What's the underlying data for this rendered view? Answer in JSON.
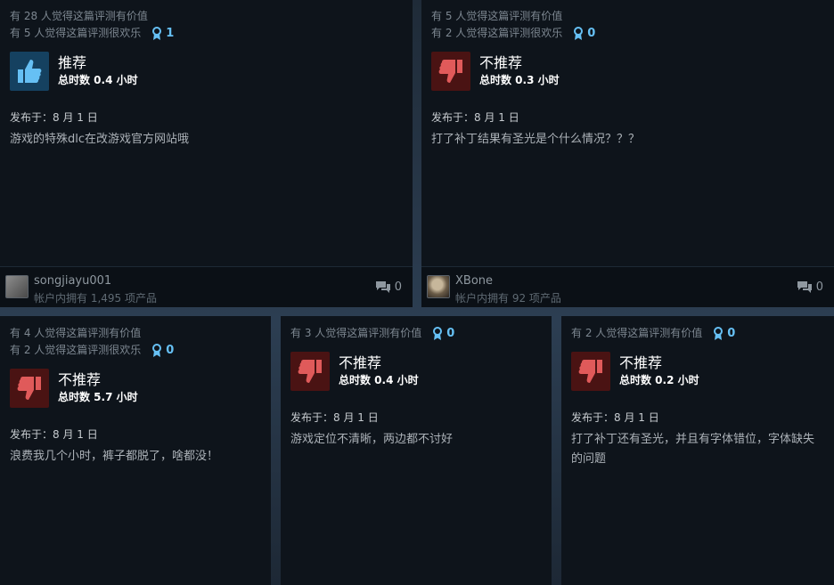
{
  "reviews": [
    {
      "helpful_line1": "有 28 人觉得这篇评测有价值",
      "helpful_line2": "有 5 人觉得这篇评测很欢乐",
      "awards": "1",
      "verdict": "推荐",
      "hours": "总时数 0.4 小时",
      "posted": "发布于：8 月 1 日",
      "body": "游戏的特殊dlc在改游戏官方网站哦",
      "username": "songjiayu001",
      "products": "帐户内拥有 1,495 项产品",
      "comments": "0",
      "thumb": "thumbs-up"
    },
    {
      "helpful_line1": "有 5 人觉得这篇评测有价值",
      "helpful_line2": "有 2 人觉得这篇评测很欢乐",
      "awards": "0",
      "verdict": "不推荐",
      "hours": "总时数 0.3 小时",
      "posted": "发布于：8 月 1 日",
      "body": "打了补丁结果有圣光是个什么情况？？？",
      "username": "XBone",
      "products": "帐户内拥有 92 项产品",
      "comments": "0",
      "thumb": "thumbs-down"
    },
    {
      "helpful_line1": "有 4 人觉得这篇评测有价值",
      "helpful_line2": "有 2 人觉得这篇评测很欢乐",
      "awards": "0",
      "verdict": "不推荐",
      "hours": "总时数 5.7 小时",
      "posted": "发布于：8 月 1 日",
      "body": "浪费我几个小时，裤子都脱了，啥都没！",
      "thumb": "thumbs-down"
    },
    {
      "helpful_line1": "有 3 人觉得这篇评测有价值",
      "awards": "0",
      "verdict": "不推荐",
      "hours": "总时数 0.4 小时",
      "posted": "发布于：8 月 1 日",
      "body": "游戏定位不清晰，两边都不讨好",
      "thumb": "thumbs-down"
    },
    {
      "helpful_line1": "有 2 人觉得这篇评测有价值",
      "awards": "0",
      "verdict": "不推荐",
      "hours": "总时数 0.2 小时",
      "posted": "发布于：8 月 1 日",
      "body": "打了补丁还有圣光，并且有字体错位，字体缺失的问题",
      "thumb": "thumbs-down"
    }
  ],
  "colors": {
    "recommended_bg": "#154160",
    "not_recommended_bg": "#4a1313",
    "award_accent": "#66c0f4"
  }
}
